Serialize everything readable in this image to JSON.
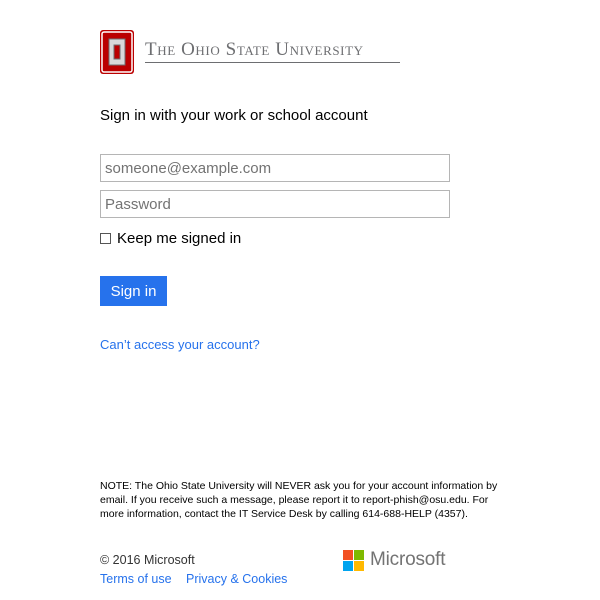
{
  "branding": {
    "university_name": "The Ohio State University",
    "logo_icon": "block-o-icon",
    "logo_colors": {
      "red": "#bb0000",
      "gray": "#6d6e71"
    }
  },
  "form": {
    "heading": "Sign in with your work or school account",
    "email_placeholder": "someone@example.com",
    "password_placeholder": "Password",
    "keep_signed_in_label": "Keep me signed in",
    "keep_signed_in_checked": false,
    "sign_in_label": "Sign in",
    "cant_access_link": "Can’t access your account?"
  },
  "note": "NOTE: The Ohio State University will NEVER ask you for your account information by email. If you receive such a message, please report it to report-phish@osu.edu. For more information, contact the IT Service Desk by calling 614-688-HELP (4357).",
  "footer": {
    "copyright": "© 2016 Microsoft",
    "terms_link": "Terms of use",
    "privacy_link": "Privacy & Cookies",
    "microsoft_wordmark": "Microsoft",
    "microsoft_colors": [
      "#f25022",
      "#7fba00",
      "#00a4ef",
      "#ffb900"
    ]
  },
  "colors": {
    "accent": "#2672ec",
    "link": "#2672ec"
  }
}
